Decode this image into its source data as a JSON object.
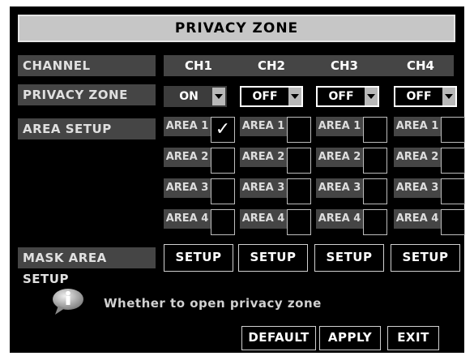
{
  "title": "PRIVACY ZONE",
  "labels": {
    "channel": "CHANNEL",
    "privacy_zone": "PRIVACY ZONE",
    "area_setup": "AREA SETUP",
    "mask_area_setup": "MASK AREA SETUP"
  },
  "channels": [
    {
      "name": "CH1",
      "privacy": "ON",
      "areas": [
        {
          "label": "AREA 1",
          "checked": true
        },
        {
          "label": "AREA 2",
          "checked": false
        },
        {
          "label": "AREA 3",
          "checked": false
        },
        {
          "label": "AREA 4",
          "checked": false
        }
      ],
      "setup_label": "SETUP"
    },
    {
      "name": "CH2",
      "privacy": "OFF",
      "areas": [
        {
          "label": "AREA 1",
          "checked": false
        },
        {
          "label": "AREA 2",
          "checked": false
        },
        {
          "label": "AREA 3",
          "checked": false
        },
        {
          "label": "AREA 4",
          "checked": false
        }
      ],
      "setup_label": "SETUP"
    },
    {
      "name": "CH3",
      "privacy": "OFF",
      "areas": [
        {
          "label": "AREA 1",
          "checked": false
        },
        {
          "label": "AREA 2",
          "checked": false
        },
        {
          "label": "AREA 3",
          "checked": false
        },
        {
          "label": "AREA 4",
          "checked": false
        }
      ],
      "setup_label": "SETUP"
    },
    {
      "name": "CH4",
      "privacy": "OFF",
      "areas": [
        {
          "label": "AREA 1",
          "checked": false
        },
        {
          "label": "AREA 2",
          "checked": false
        },
        {
          "label": "AREA 3",
          "checked": false
        },
        {
          "label": "AREA 4",
          "checked": false
        }
      ],
      "setup_label": "SETUP"
    }
  ],
  "check_mark": "✓",
  "info": {
    "icon": "info-icon",
    "text": "Whether to open privacy zone"
  },
  "buttons": {
    "default": "DEFAULT",
    "apply": "APPLY",
    "exit": "EXIT"
  },
  "colors": {
    "background": "#000000",
    "label_bg": "#454545",
    "title_bg": "#c6c6c6"
  }
}
